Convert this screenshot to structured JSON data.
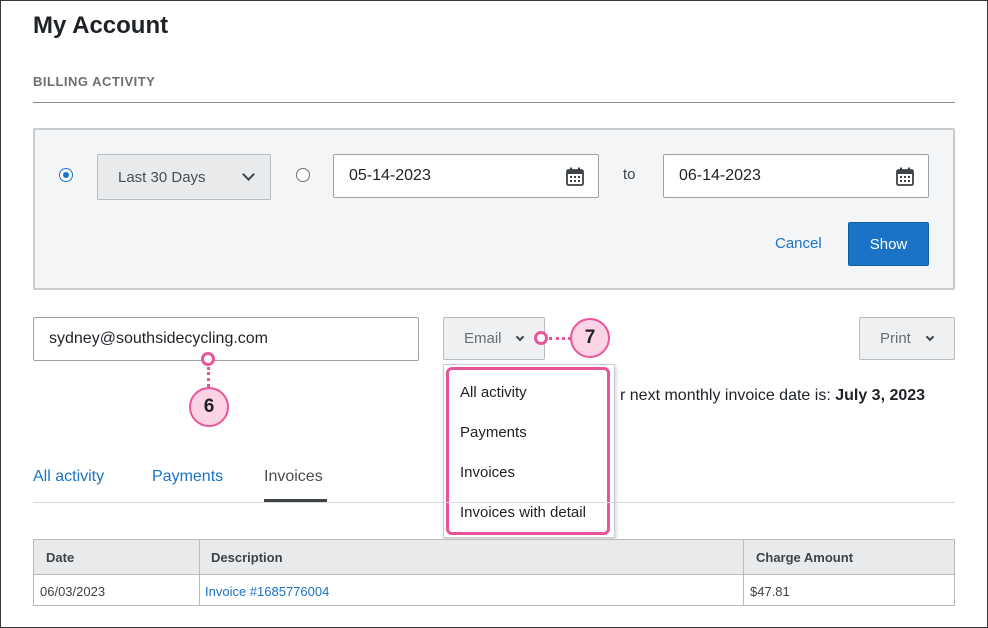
{
  "page": {
    "title": "My Account",
    "section_label": "BILLING ACTIVITY"
  },
  "filter": {
    "preset_selected": true,
    "preset_value": "Last 30 Days",
    "start_date": "05-14-2023",
    "to_label": "to",
    "end_date": "06-14-2023",
    "cancel_label": "Cancel",
    "show_label": "Show"
  },
  "actions": {
    "email_value": "sydney@southsidecycling.com",
    "email_button_label": "Email",
    "print_button_label": "Print"
  },
  "email_menu": {
    "items": [
      "All activity",
      "Payments",
      "Invoices",
      "Invoices with detail"
    ]
  },
  "invoice_note": {
    "prefix": "r next monthly invoice date is: ",
    "date": "July 3, 2023"
  },
  "callouts": {
    "email_field": "6",
    "email_menu": "7"
  },
  "tabs": [
    {
      "label": "All activity",
      "active": false
    },
    {
      "label": "Payments",
      "active": false
    },
    {
      "label": "Invoices",
      "active": true
    }
  ],
  "table": {
    "columns": [
      "Date",
      "Description",
      "Charge Amount"
    ],
    "rows": [
      {
        "date": "06/03/2023",
        "description": "Invoice #1685776004",
        "amount": "$47.81"
      }
    ]
  },
  "colors": {
    "accent": "#1a73c7",
    "highlight": "#e9559b",
    "highlight_fill": "#fbd3e5"
  },
  "icons": {
    "date_picker": "calendar-icon",
    "dropdown": "chevron-down-icon"
  }
}
